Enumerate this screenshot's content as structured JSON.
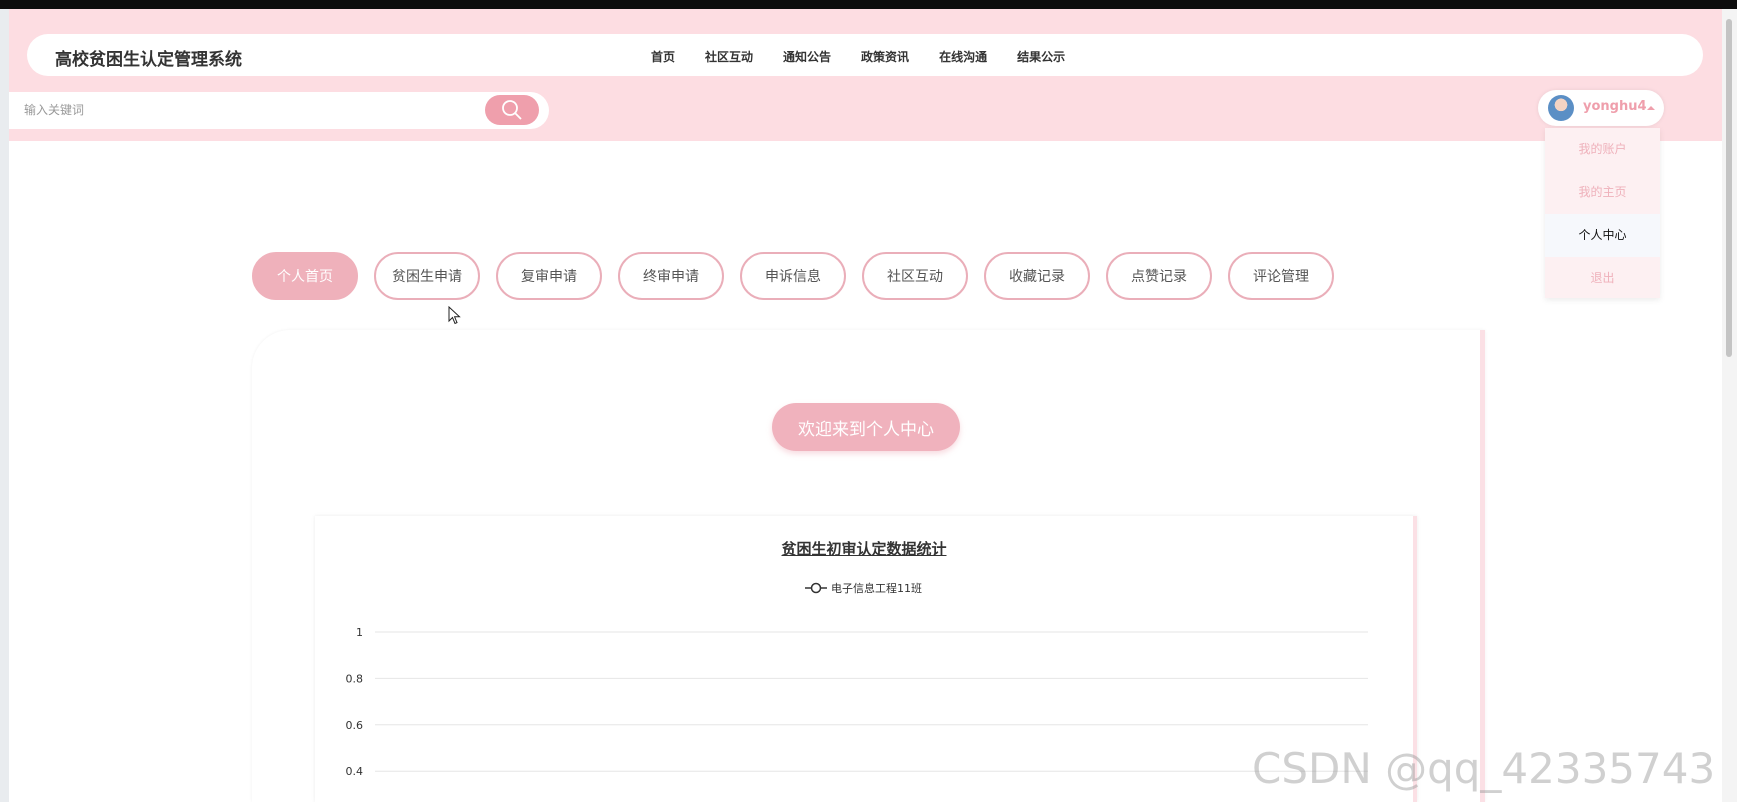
{
  "site": {
    "title": "高校贫困生认定管理系统"
  },
  "menu": [
    "首页",
    "社区互动",
    "通知公告",
    "政策资讯",
    "在线沟通",
    "结果公示"
  ],
  "search": {
    "placeholder": "输入关键词"
  },
  "user": {
    "name": "yonghu4"
  },
  "dropdown": [
    "我的账户",
    "我的主页",
    "个人中心",
    "退出"
  ],
  "tabs": [
    "个人首页",
    "贫困生申请",
    "复审申请",
    "终审申请",
    "申诉信息",
    "社区互动",
    "收藏记录",
    "点赞记录",
    "评论管理"
  ],
  "welcome": "欢迎来到个人中心",
  "chart_data": {
    "type": "line",
    "title": "贫困生初审认定数据统计",
    "series": [
      {
        "name": "电子信息工程11班",
        "values": []
      }
    ],
    "yticks": [
      "1",
      "0.8",
      "0.6",
      "0.4"
    ],
    "ylim": [
      0,
      1
    ],
    "grid": true,
    "legend": "top-center"
  },
  "watermark": "CSDN @qq_42335743",
  "colors": {
    "accent": "#ef9fac",
    "header_bg": "#fddde2"
  }
}
